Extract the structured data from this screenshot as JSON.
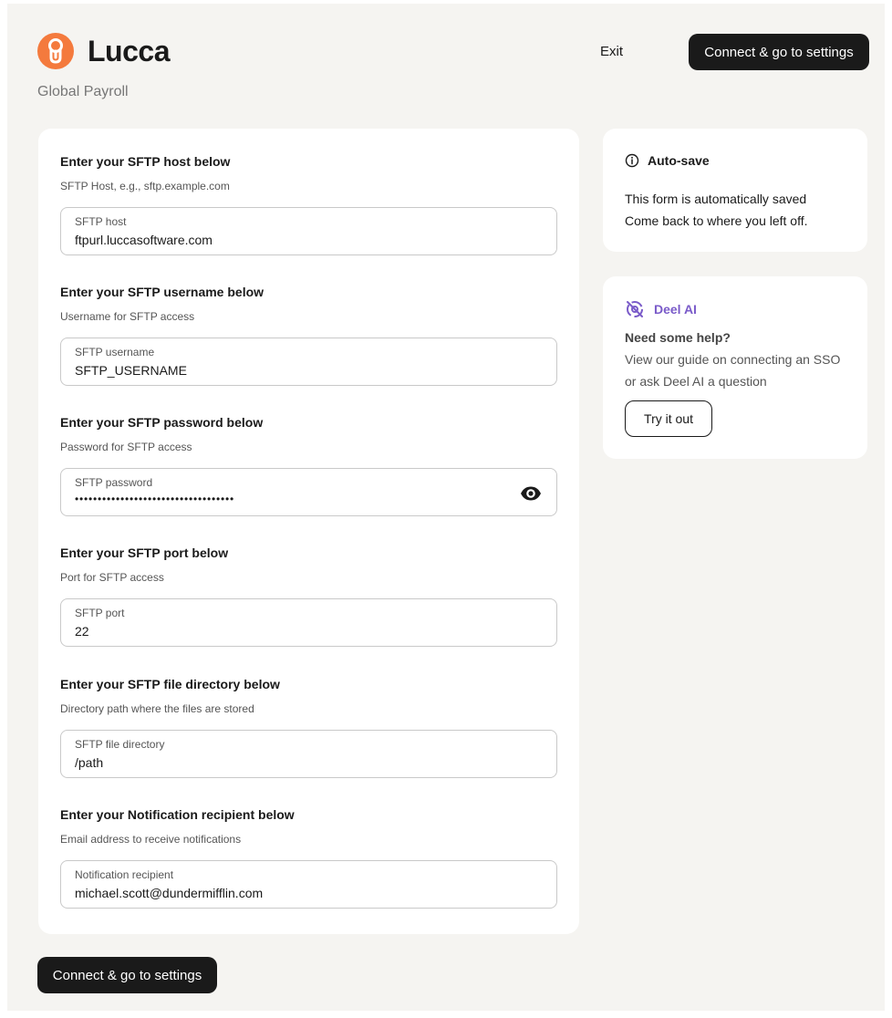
{
  "header": {
    "brand": "Lucca",
    "subtitle": "Global Payroll",
    "exit_label": "Exit",
    "connect_label": "Connect & go to settings"
  },
  "form": {
    "sections": [
      {
        "title": "Enter your SFTP host below",
        "help": "SFTP Host, e.g., sftp.example.com",
        "label": "SFTP host",
        "value": "ftpurl.luccasoftware.com"
      },
      {
        "title": "Enter your SFTP username below",
        "help": "Username for SFTP access",
        "label": "SFTP username",
        "value": "SFTP_USERNAME"
      },
      {
        "title": "Enter your SFTP password below",
        "help": "Password for SFTP access",
        "label": "SFTP password",
        "value": "•••••••••••••••••••••••••••••••••••"
      },
      {
        "title": "Enter your SFTP port below",
        "help": "Port for SFTP access",
        "label": "SFTP port",
        "value": "22"
      },
      {
        "title": "Enter your SFTP file directory below",
        "help": "Directory path where the files are stored",
        "label": "SFTP file directory",
        "value": "/path"
      },
      {
        "title": "Enter your Notification recipient below",
        "help": "Email address to receive notifications",
        "label": "Notification recipient",
        "value": "michael.scott@dundermifflin.com"
      }
    ]
  },
  "autosave": {
    "icon": "info-icon",
    "title": "Auto-save",
    "line1": "This form is automatically saved",
    "line2": "Come back to where you left off."
  },
  "deel_ai": {
    "icon": "deel-ai-icon",
    "title": "Deel AI",
    "question": "Need some help?",
    "text": "View our guide on connecting an SSO or ask Deel AI a question",
    "button_label": "Try it out"
  },
  "footer": {
    "connect_label": "Connect & go to settings"
  },
  "colors": {
    "brand_orange": "#f47a3d",
    "deel_purple": "#7a5bc9",
    "button_dark": "#1a1a1a",
    "background": "#f5f4f1"
  }
}
